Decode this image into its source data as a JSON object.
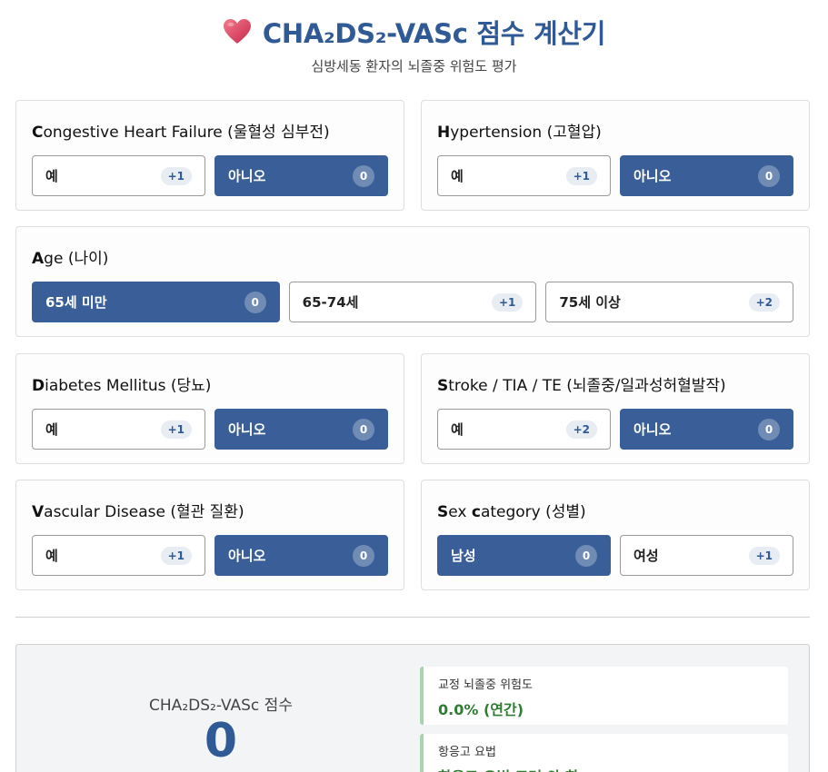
{
  "header": {
    "title": "CHA₂DS₂-VASc 점수 계산기",
    "subtitle": "심방세동 환자의 뇌졸중 위험도 평가"
  },
  "criteria": {
    "chf": {
      "initial": "C",
      "title_rest": "ongestive Heart Failure (울혈성 심부전)",
      "options": [
        {
          "label": "예",
          "points": "+1"
        },
        {
          "label": "아니오",
          "points": "0"
        }
      ],
      "selected": "아니오"
    },
    "htn": {
      "initial": "H",
      "title_rest": "ypertension (고혈압)",
      "options": [
        {
          "label": "예",
          "points": "+1"
        },
        {
          "label": "아니오",
          "points": "0"
        }
      ],
      "selected": "아니오"
    },
    "age": {
      "initial": "A",
      "title_rest": "ge (나이)",
      "options": [
        {
          "label": "65세 미만",
          "points": "0"
        },
        {
          "label": "65-74세",
          "points": "+1"
        },
        {
          "label": "75세 이상",
          "points": "+2"
        }
      ],
      "selected": "65세 미만"
    },
    "dm": {
      "initial": "D",
      "title_rest": "iabetes Mellitus (당뇨)",
      "options": [
        {
          "label": "예",
          "points": "+1"
        },
        {
          "label": "아니오",
          "points": "0"
        }
      ],
      "selected": "아니오"
    },
    "stroke": {
      "initial": "S",
      "title_rest": "troke / TIA / TE (뇌졸중/일과성허혈발작)",
      "options": [
        {
          "label": "예",
          "points": "+2"
        },
        {
          "label": "아니오",
          "points": "0"
        }
      ],
      "selected": "아니오"
    },
    "vasc": {
      "initial": "V",
      "title_rest": "ascular Disease (혈관 질환)",
      "options": [
        {
          "label": "예",
          "points": "+1"
        },
        {
          "label": "아니오",
          "points": "0"
        }
      ],
      "selected": "아니오"
    },
    "sex": {
      "initial": "S",
      "title_mid": "ex ",
      "initial2": "c",
      "title_rest": "ategory (성별)",
      "options": [
        {
          "label": "남성",
          "points": "0"
        },
        {
          "label": "여성",
          "points": "+1"
        }
      ],
      "selected": "남성"
    }
  },
  "result": {
    "score_label": "CHA₂DS₂-VASc 점수",
    "score_value": "0",
    "risk_label": "교정 뇌졸중 위험도",
    "risk_value": "0.0% (연간)",
    "anticoag_label": "항응고 요법",
    "anticoag_value": "항응고 요법 고려 안 함"
  },
  "colors": {
    "accent": "#2f5a95",
    "selected_bg": "#3a5f98",
    "success": "#2e7d32",
    "heart": "#e0445c"
  },
  "icons": {
    "title_icon": "heart-icon"
  }
}
